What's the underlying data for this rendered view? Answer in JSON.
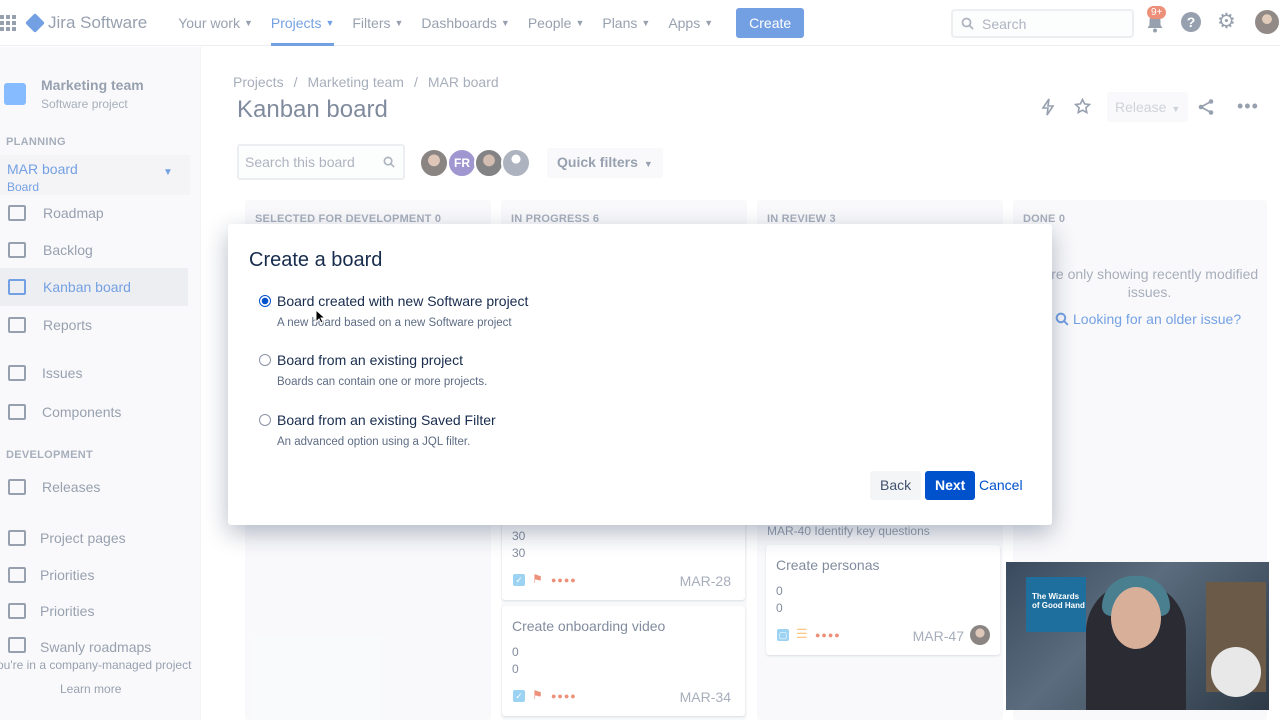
{
  "topnav": {
    "logo_text": "Jira Software",
    "items": [
      {
        "label": "Your work"
      },
      {
        "label": "Projects"
      },
      {
        "label": "Filters"
      },
      {
        "label": "Dashboards"
      },
      {
        "label": "People"
      },
      {
        "label": "Plans"
      },
      {
        "label": "Apps"
      }
    ],
    "active_item": "Projects",
    "create_label": "Create",
    "search_placeholder": "Search",
    "notification_count": "9+"
  },
  "sidebar": {
    "project_name": "Marketing team",
    "project_type": "Software project",
    "planning_title": "PLANNING",
    "board_name": "MAR board",
    "board_type": "Board",
    "planning_items": [
      {
        "label": "Roadmap"
      },
      {
        "label": "Backlog"
      },
      {
        "label": "Kanban board"
      },
      {
        "label": "Reports"
      },
      {
        "label": "Issues"
      },
      {
        "label": "Components"
      }
    ],
    "development_title": "DEVELOPMENT",
    "development_items": [
      {
        "label": "Releases"
      },
      {
        "label": "Project pages"
      },
      {
        "label": "Priorities"
      },
      {
        "label": "Priorities"
      },
      {
        "label": "Swanly roadmaps"
      }
    ],
    "company_note": "ou're in a company-managed project",
    "learn_more": "Learn more"
  },
  "main": {
    "breadcrumb": [
      "Projects",
      "Marketing team",
      "MAR board"
    ],
    "title": "Kanban board",
    "release_label": "Release",
    "board_search_placeholder": "Search this board",
    "avatar_initials": "FR",
    "quick_filters_label": "Quick filters",
    "columns": [
      {
        "title": "SELECTED FOR DEVELOPMENT",
        "count": "0"
      },
      {
        "title": "IN PROGRESS",
        "count": "6"
      },
      {
        "title": "IN REVIEW",
        "count": "3"
      },
      {
        "title": "DONE",
        "count": "0"
      }
    ],
    "cards": {
      "c1": {
        "num1": "30",
        "num2": "30",
        "key": "MAR-28"
      },
      "c2": {
        "title": "Create onboarding video",
        "num1": "0",
        "num2": "0",
        "key": "MAR-34"
      },
      "c3_parent": "MAR-40",
      "c3_parent_title": "Identify key questions",
      "c3": {
        "title": "Create personas",
        "num1": "0",
        "num2": "0",
        "key": "MAR-47"
      }
    },
    "done_message": "u're only showing recently modified issues.",
    "older_link": "Looking for an older issue?"
  },
  "modal": {
    "title": "Create a board",
    "options": [
      {
        "label": "Board created with new Software project",
        "desc": "A new board based on a new Software project",
        "selected": true
      },
      {
        "label": "Board from an existing project",
        "desc": "Boards can contain one or more projects.",
        "selected": false
      },
      {
        "label": "Board from an existing Saved Filter",
        "desc": "An advanced option using a JQL filter.",
        "selected": false
      }
    ],
    "back_label": "Back",
    "next_label": "Next",
    "cancel_label": "Cancel"
  },
  "webcam": {
    "poster_text": "The Wizards of Good Hand"
  },
  "colors": {
    "brand": "#0052cc",
    "sidebar_bg": "#f4f5f7",
    "text": "#172b4d"
  }
}
